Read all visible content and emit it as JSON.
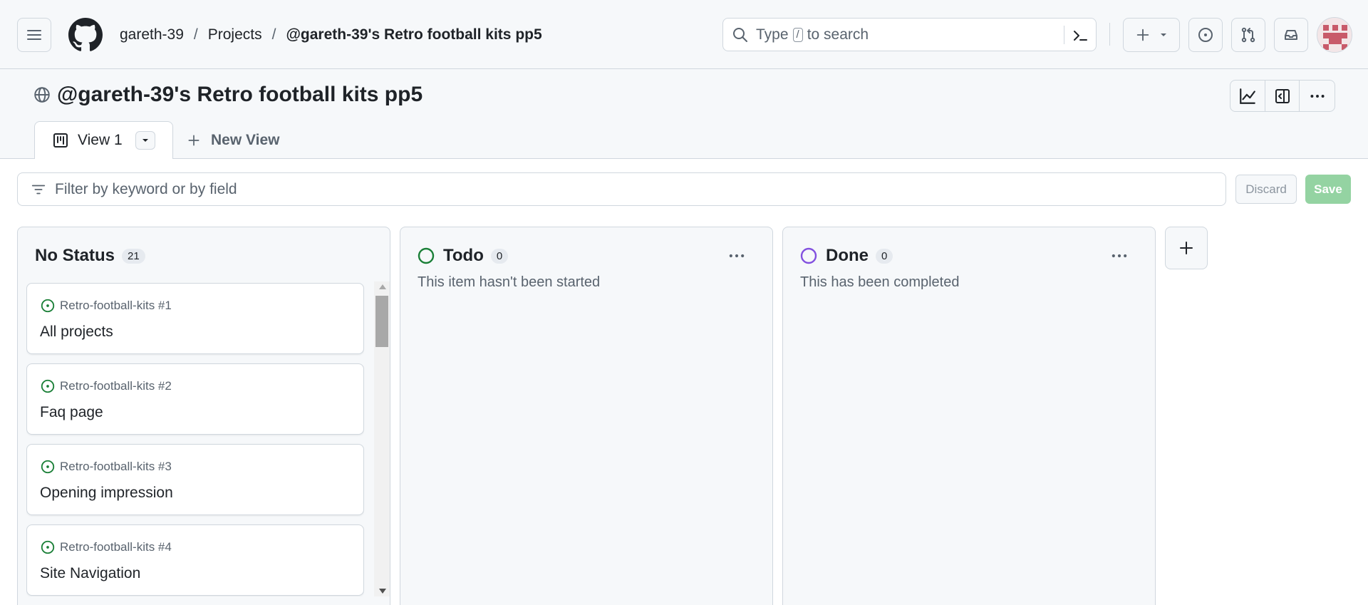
{
  "header": {
    "breadcrumb": {
      "owner": "gareth-39",
      "section": "Projects",
      "project": "@gareth-39's Retro football kits pp5"
    },
    "search": {
      "prefix": "Type",
      "key": "/",
      "suffix": "to search"
    }
  },
  "project": {
    "title": "@gareth-39's Retro football kits pp5"
  },
  "tabs": {
    "active": "View 1",
    "new_view": "New View"
  },
  "filter": {
    "placeholder": "Filter by keyword or by field",
    "discard_label": "Discard",
    "save_label": "Save"
  },
  "columns": [
    {
      "name": "No Status",
      "count": "21",
      "description": "",
      "cards": [
        {
          "ref": "Retro-football-kits #1",
          "title": "All projects"
        },
        {
          "ref": "Retro-football-kits #2",
          "title": "Faq page"
        },
        {
          "ref": "Retro-football-kits #3",
          "title": "Opening impression"
        },
        {
          "ref": "Retro-football-kits #4",
          "title": "Site Navigation"
        }
      ]
    },
    {
      "name": "Todo",
      "count": "0",
      "description": "This item hasn't been started",
      "status_color": "#1a7f37"
    },
    {
      "name": "Done",
      "count": "0",
      "description": "This has been completed",
      "status_color": "#8250df"
    }
  ],
  "colors": {
    "accent_green": "#1a7f37",
    "done_purple": "#8250df",
    "save_disabled": "#94d3a2"
  },
  "icons": {
    "menu": "hamburger-icon",
    "logo": "github-logo-icon",
    "search": "search-icon",
    "command": "command-palette-icon",
    "create": "plus-icon",
    "issues": "issue-opened-icon",
    "pulls": "git-pull-request-icon",
    "inbox": "inbox-icon",
    "insights": "graph-icon",
    "panel": "sidebar-expand-icon",
    "more": "kebab-horizontal-icon",
    "visibility": "globe-icon",
    "board": "project-board-icon",
    "filter": "filter-icon"
  }
}
